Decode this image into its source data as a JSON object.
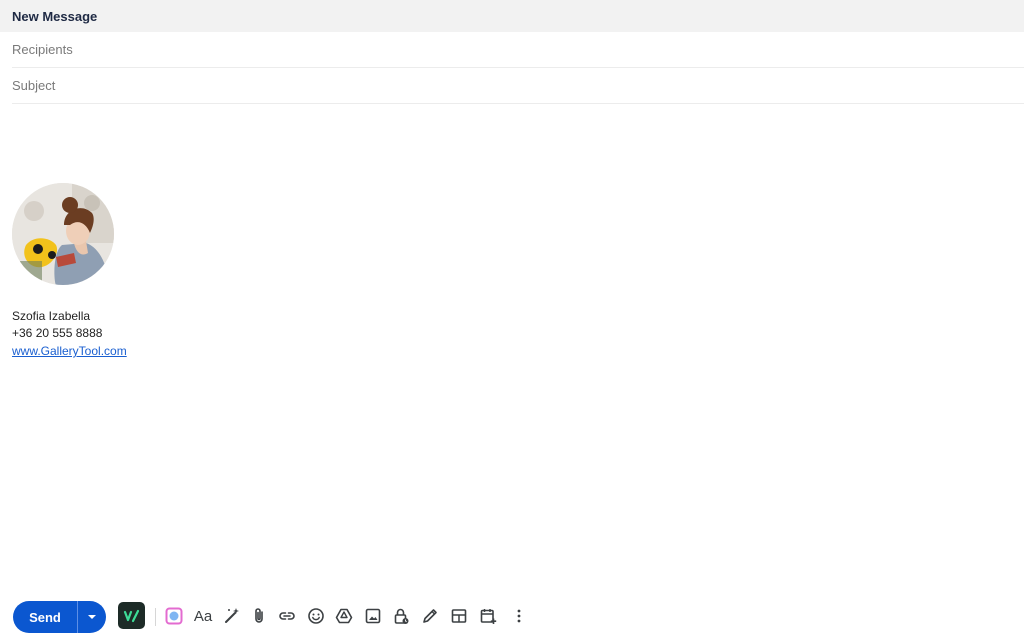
{
  "window": {
    "title": "New Message"
  },
  "fields": {
    "recipients_placeholder": "Recipients",
    "subject_placeholder": "Subject"
  },
  "signature": {
    "name": "Szofia Izabella",
    "phone": "+36 20 555 8888",
    "website": "www.GalleryTool.com"
  },
  "toolbar": {
    "send_label": "Send",
    "format_label": "Aa",
    "icons": [
      "extension-icon",
      "colorful-app-icon",
      "formatting-icon",
      "magic-wand-icon",
      "attach-icon",
      "link-icon",
      "emoji-icon",
      "drive-icon",
      "photo-icon",
      "confidential-mode-icon",
      "signature-pen-icon",
      "layout-icon",
      "schedule-event-icon",
      "more-options-icon"
    ]
  },
  "colors": {
    "send_blue": "#0b57d0",
    "link_blue": "#1a5fd0",
    "header_bg": "#f2f2f2",
    "extension_bg": "#1d2b27",
    "extension_accent": "#3ddc97"
  }
}
